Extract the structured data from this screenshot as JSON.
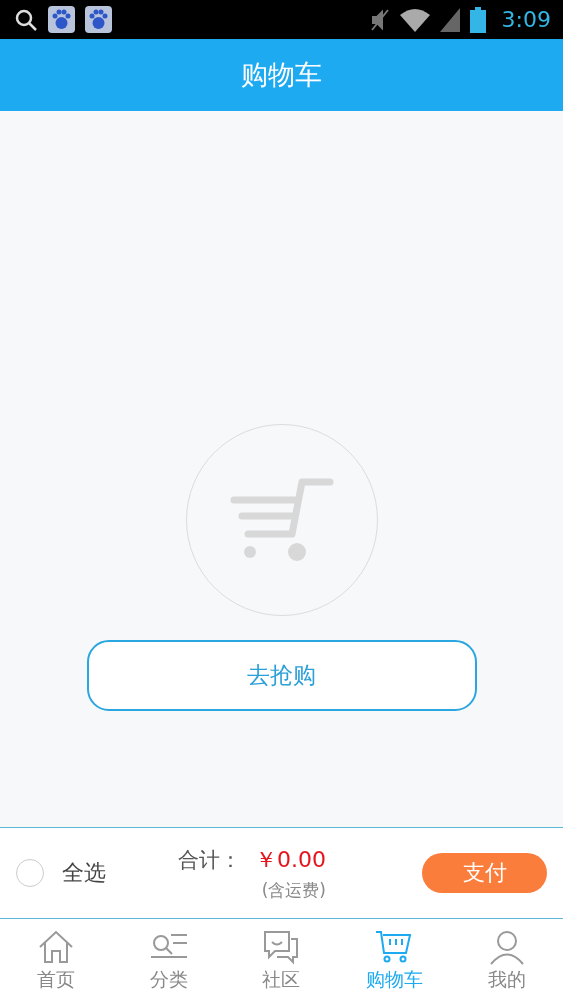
{
  "status_bar": {
    "time": "3:09"
  },
  "header": {
    "title": "购物车"
  },
  "empty_cart": {
    "button": "去抢购"
  },
  "checkout": {
    "select_all": {
      "label": "全选",
      "checked": false
    },
    "total_label": "合计：",
    "total": "￥0.00",
    "shipping_note": "(含运费)",
    "pay_button": "支付"
  },
  "tabs": [
    {
      "label": "首页",
      "kind": "home",
      "selected": false
    },
    {
      "label": "分类",
      "kind": "category",
      "selected": false
    },
    {
      "label": "社区",
      "kind": "community",
      "selected": false
    },
    {
      "label": "购物车",
      "kind": "cart",
      "selected": true
    },
    {
      "label": "我的",
      "kind": "profile",
      "selected": false
    }
  ]
}
